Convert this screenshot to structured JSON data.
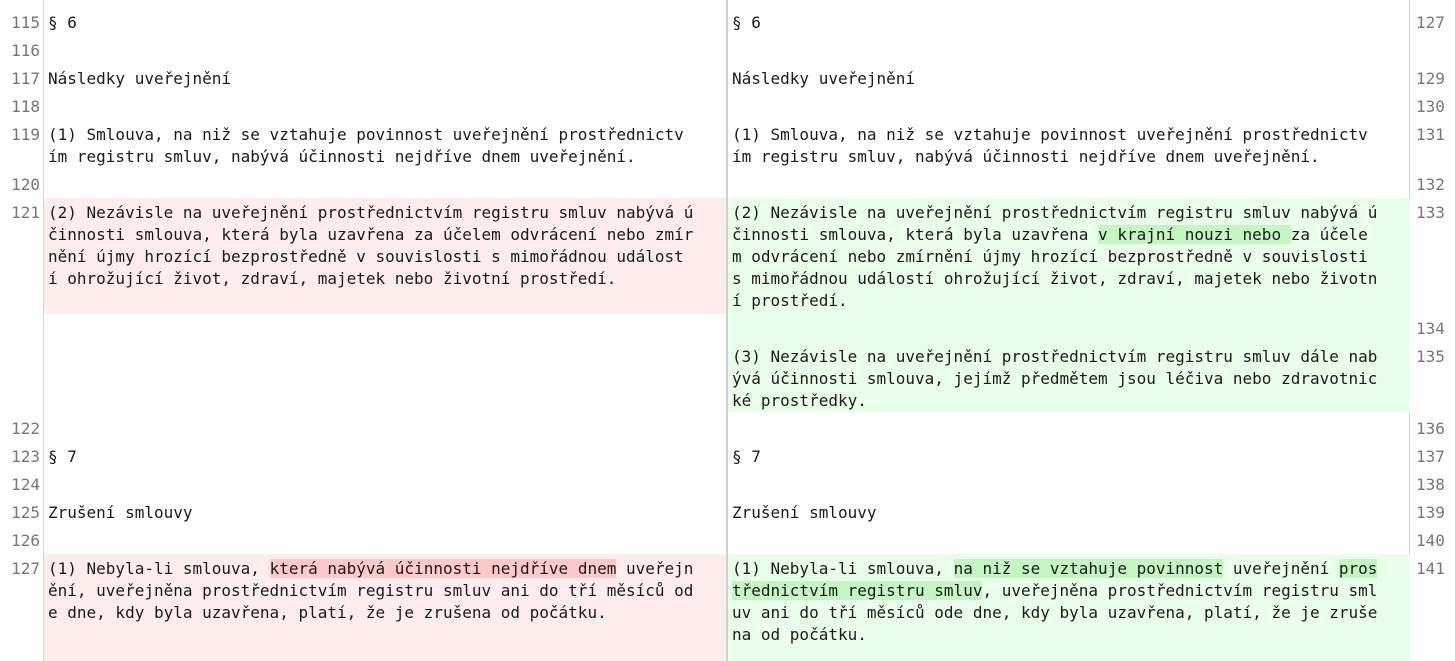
{
  "left": {
    "line_numbers": [
      "115",
      "116",
      "117",
      "118",
      "119",
      "120",
      "121",
      "122",
      "123",
      "124",
      "125",
      "126",
      "127"
    ],
    "lines": {
      "l115": "§ 6",
      "l117": "Následky uveřejnění",
      "l119a": "(1) Smlouva, na niž se vztahuje povinnost uveřejnění prostřednictv",
      "l119b": "ím registru smluv, nabývá účinnosti nejdříve dnem uveřejnění.",
      "l121a": "(2) Nezávisle na uveřejnění prostřednictvím registru smluv nabývá ú",
      "l121b": "činnosti smlouva, která byla uzavřena za účelem odvrácení nebo zmír",
      "l121c": "nění újmy hrozící bezprostředně v souvislosti s mimořádnou událost",
      "l121d": "í ohrožující život, zdraví, majetek nebo životní prostředí.",
      "l123": "§ 7",
      "l125": "Zrušení smlouvy",
      "l127a_pre": "(1) Nebyla-li smlouva, ",
      "l127a_del": "která nabývá účinnosti nejdříve dnem",
      "l127a_post": " uveřejn",
      "l127b": "ění, uveřejněna prostřednictvím registru smluv ani do tří měsíců od",
      "l127c": "e dne, kdy byla uzavřena, platí, že je zrušena od počátku."
    }
  },
  "right": {
    "line_numbers": [
      "127",
      "129",
      "130",
      "131",
      "132",
      "133",
      "134",
      "135",
      "136",
      "137",
      "138",
      "139",
      "140",
      "141"
    ],
    "lines": {
      "r127": "§ 6",
      "r129": "Následky uveřejnění",
      "r131a": "(1) Smlouva, na niž se vztahuje povinnost uveřejnění prostřednictv",
      "r131b": "ím registru smluv, nabývá účinnosti nejdříve dnem uveřejnění.",
      "r133a": "(2) Nezávisle na uveřejnění prostřednictvím registru smluv nabývá ú",
      "r133b_pre": "činnosti smlouva, která byla uzavřena ",
      "r133b_ins": "v krajní nouzi nebo ",
      "r133b_post": "za účele",
      "r133c": "m odvrácení nebo zmírnění újmy hrozící bezprostředně v souvislosti",
      "r133d": "s mimořádnou událostí ohrožující život, zdraví, majetek nebo životn",
      "r133e": "í prostředí.",
      "r135a": "(3) Nezávisle na uveřejnění prostřednictvím registru smluv dále nab",
      "r135b": "ývá účinnosti smlouva, jejímž předmětem jsou léčiva nebo zdravotnic",
      "r135c": "ké prostředky.",
      "r137": "§ 7",
      "r139": "Zrušení smlouvy",
      "r141a_pre": "(1) Nebyla-li smlouva, ",
      "r141a_ins": "na niž se vztahuje povinnost",
      "r141a_mid": " uveřejnění ",
      "r141a_ins2": "pros",
      "r141b_ins": "třednictvím registru smluv",
      "r141b_post": ", uveřejněna prostřednictvím registru sml",
      "r141c": "uv ani do tří měsíců ode dne, kdy byla uzavřena, platí, že je zruše",
      "r141d": "na od počátku."
    }
  },
  "colors": {
    "deleted_bg": "#ffecec",
    "deleted_highlight": "#ffc9c9",
    "inserted_bg": "#eaffe9",
    "inserted_highlight": "#c6f5c4"
  }
}
